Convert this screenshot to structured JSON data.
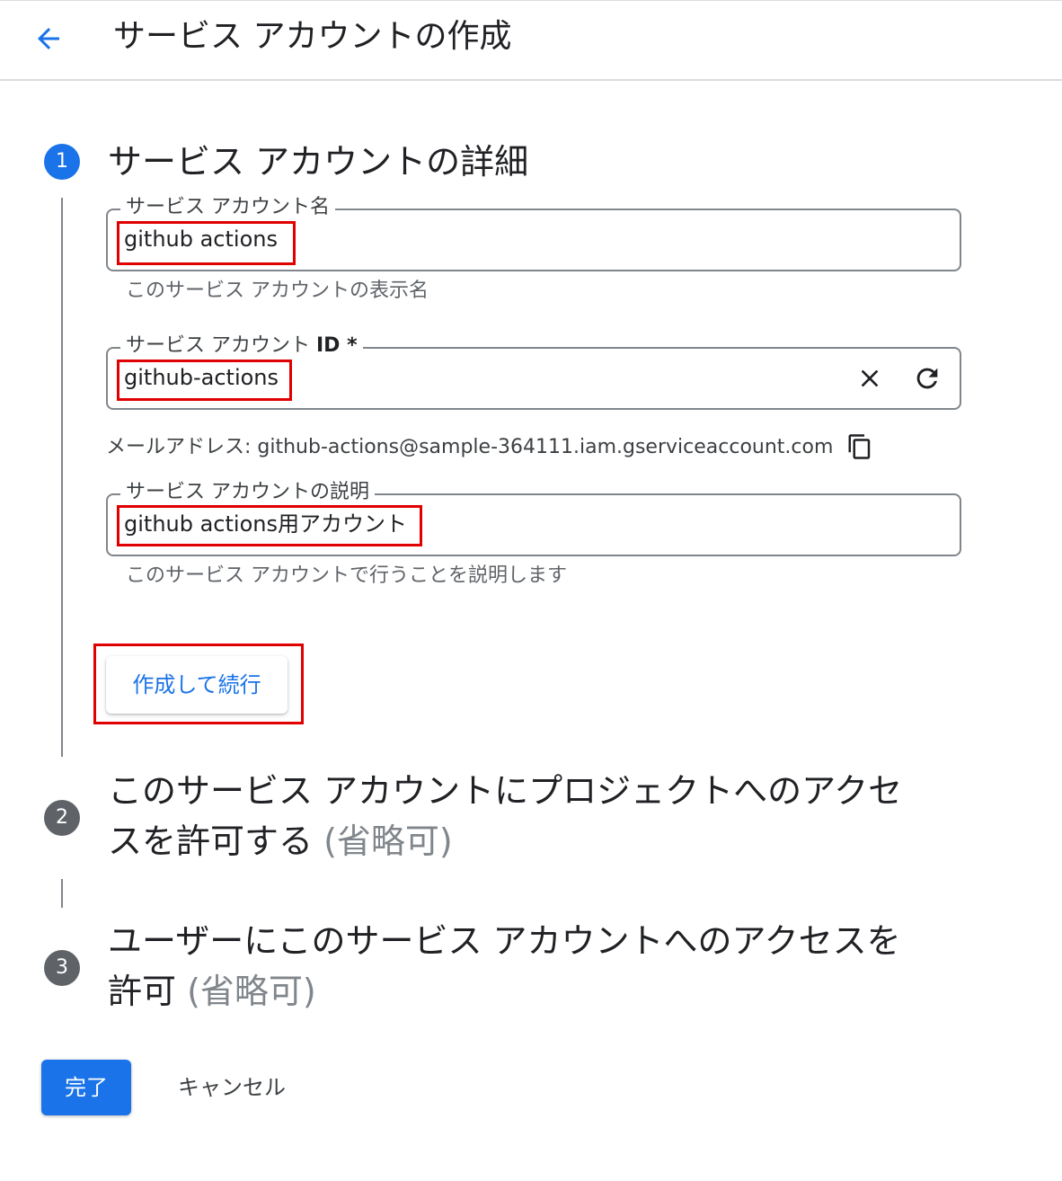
{
  "header": {
    "title": "サービス アカウントの作成"
  },
  "steps": [
    {
      "number": "1",
      "title": "サービス アカウントの詳細"
    },
    {
      "number": "2",
      "title_line1": "このサービス アカウントにプロジェクトへのアクセ",
      "title_line2": "スを許可する",
      "optional": "(省略可)"
    },
    {
      "number": "3",
      "title_line1": "ユーザーにこのサービス アカウントへのアクセスを",
      "title_line2": "許可",
      "optional": "(省略可)"
    }
  ],
  "form": {
    "name": {
      "label": "サービス アカウント名",
      "value": "github actions",
      "hint": "このサービス アカウントの表示名"
    },
    "id": {
      "label": "サービス アカウント",
      "label_suffix": "ID *",
      "value": "github-actions",
      "clear_icon": "close-icon",
      "refresh_icon": "refresh-icon"
    },
    "email": {
      "text": "メールアドレス: github-actions@sample-364111.iam.gserviceaccount.com",
      "copy_icon": "copy-icon"
    },
    "description": {
      "label": "サービス アカウントの説明",
      "value": "github actions用アカウント",
      "hint": "このサービス アカウントで行うことを説明します"
    }
  },
  "buttons": {
    "create_continue": "作成して続行",
    "done": "完了",
    "cancel": "キャンセル"
  },
  "colors": {
    "primary": "#1a73e8",
    "highlight": "#e00000",
    "step_inactive": "#5f6368"
  }
}
